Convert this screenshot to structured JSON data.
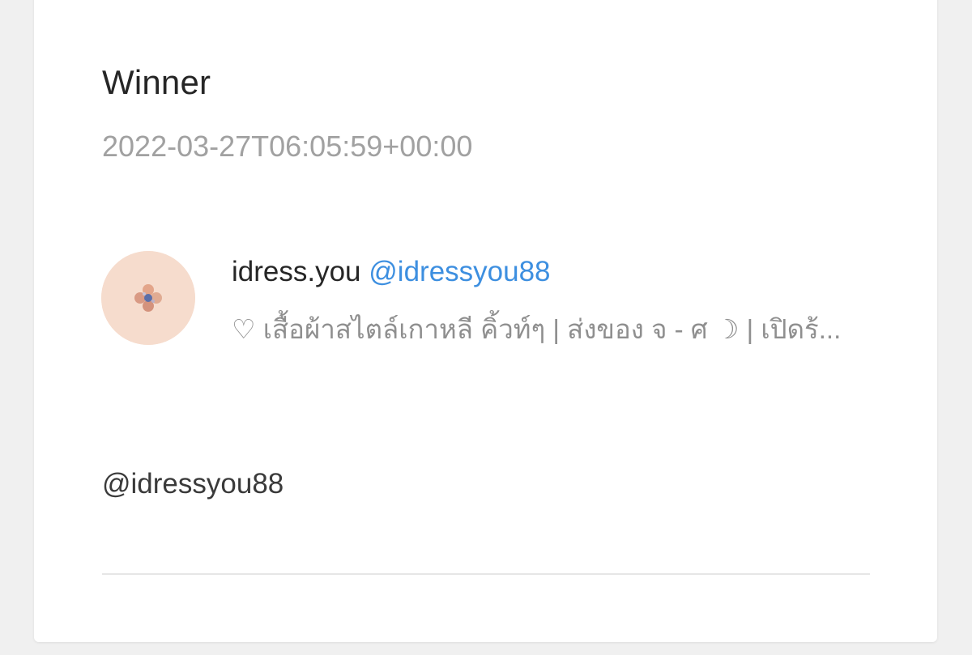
{
  "card": {
    "title": "Winner",
    "timestamp": "2022-03-27T06:05:59+00:00"
  },
  "account": {
    "display_name": "idress.you",
    "handle": "@idressyou88",
    "bio": "♡ เสื้อผ้าสไตล์เกาหลี คิ้วท์ๆ | ส่งของ จ - ศ ☽ | เปิดร้...",
    "avatar_color": "#f6dccd"
  },
  "post": {
    "mention": "@idressyou88"
  },
  "colors": {
    "handle": "#3d8fe0",
    "muted": "#a1a1a1"
  }
}
